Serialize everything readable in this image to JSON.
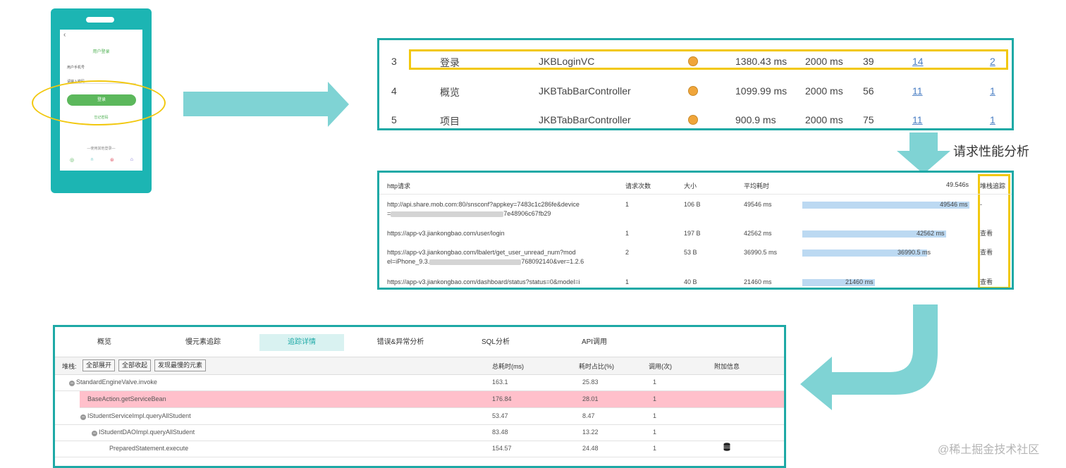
{
  "colors": {
    "teal": "#1ea9a6",
    "highlight": "#f2c80f",
    "status_dot": "#f0a53a",
    "bar": "#bcd9f2",
    "pink_row": "#ffc0cb",
    "arrow": "#7fd3d4"
  },
  "phone": {
    "back": "‹",
    "title": "用户登录",
    "phone_label": "用户手机号",
    "password_hint": "请输入密码",
    "login_button": "登录",
    "forgot_link": "忘记密码",
    "other_login": "—使用其他登录—",
    "social_icons": [
      "wechat-icon",
      "qq-icon",
      "weibo-icon",
      "other-icon"
    ]
  },
  "slow_pages": {
    "rows": [
      {
        "index": "3",
        "name": "登录",
        "controller": "JKBLoginVC",
        "avg": "1380.43 ms",
        "threshold": "2000 ms",
        "count": "39",
        "slow": "14",
        "trace": "2"
      },
      {
        "index": "4",
        "name": "概览",
        "controller": "JKBTabBarController",
        "avg": "1099.99 ms",
        "threshold": "2000 ms",
        "count": "56",
        "slow": "11",
        "trace": "1"
      },
      {
        "index": "5",
        "name": "项目",
        "controller": "JKBTabBarController",
        "avg": "900.9 ms",
        "threshold": "2000 ms",
        "count": "75",
        "slow": "11",
        "trace": "1"
      }
    ]
  },
  "caption": "请求性能分析",
  "http_requests": {
    "headers": {
      "url": "http请求",
      "count": "请求次数",
      "size": "大小",
      "avg": "平均耗时",
      "max": "49.546s",
      "stack": "堆栈追踪"
    },
    "max_ms": 49546,
    "rows": [
      {
        "url1": "http://api.share.mob.com:80/snsconf?appkey=7483c1c286fe&device",
        "url2": "=",
        "url2_tail": "7e48906c67fb29",
        "count": "1",
        "size": "106 B",
        "avg": "49546 ms",
        "value": 49546,
        "bar_label": "49546 ms",
        "stack": "-"
      },
      {
        "url1": "https://app-v3.jiankongbao.com/user/login",
        "url2": "",
        "url2_tail": "",
        "count": "1",
        "size": "197 B",
        "avg": "42562 ms",
        "value": 42562,
        "bar_label": "42562 ms",
        "stack": "查看"
      },
      {
        "url1": "https://app-v3.jiankongbao.com/lbalert/get_user_unread_num?mod",
        "url2": "el=iPhone_9.3.",
        "url2_tail": "768092140&ver=1.2.6",
        "count": "2",
        "size": "53 B",
        "avg": "36990.5 ms",
        "value": 36990.5,
        "bar_label": "36990.5 ms",
        "stack": "查看"
      },
      {
        "url1": "https://app-v3.jiankongbao.com/dashboard/status?status=0&model=i",
        "url2": "",
        "url2_tail": "",
        "count": "1",
        "size": "40 B",
        "avg": "21460 ms",
        "value": 21460,
        "bar_label": "21460 ms",
        "stack": "查看"
      }
    ]
  },
  "trace": {
    "tabs": [
      "概览",
      "慢元素追踪",
      "追踪详情",
      "错误&异常分析",
      "SQL分析",
      "API调用"
    ],
    "active_tab": 2,
    "stack_label": "堆栈:",
    "buttons": [
      "全部展开",
      "全部收起",
      "发现最慢的元素"
    ],
    "columns": {
      "total": "总耗时(ms)",
      "ratio": "耗时占比(%)",
      "calls": "调用(次)",
      "extra": "附加信息"
    },
    "rows": [
      {
        "method": "StandardEngineValve.invoke",
        "total": "163.1",
        "ratio": "25.83",
        "calls": "1",
        "expander": true,
        "highlight": false,
        "extra_icon": ""
      },
      {
        "method": "BaseAction.getServiceBean",
        "total": "176.84",
        "ratio": "28.01",
        "calls": "1",
        "expander": false,
        "highlight": true,
        "extra_icon": ""
      },
      {
        "method": "IStudentServiceImpl.queryAllStudent",
        "total": "53.47",
        "ratio": "8.47",
        "calls": "1",
        "expander": true,
        "highlight": false,
        "extra_icon": ""
      },
      {
        "method": "IStudentDAOImpl.queryAllStudent",
        "total": "83.48",
        "ratio": "13.22",
        "calls": "1",
        "expander": true,
        "highlight": false,
        "extra_icon": ""
      },
      {
        "method": "PreparedStatement.execute",
        "total": "154.57",
        "ratio": "24.48",
        "calls": "1",
        "expander": false,
        "highlight": false,
        "extra_icon": "database-icon"
      }
    ]
  },
  "watermark": "@稀土掘金技术社区"
}
